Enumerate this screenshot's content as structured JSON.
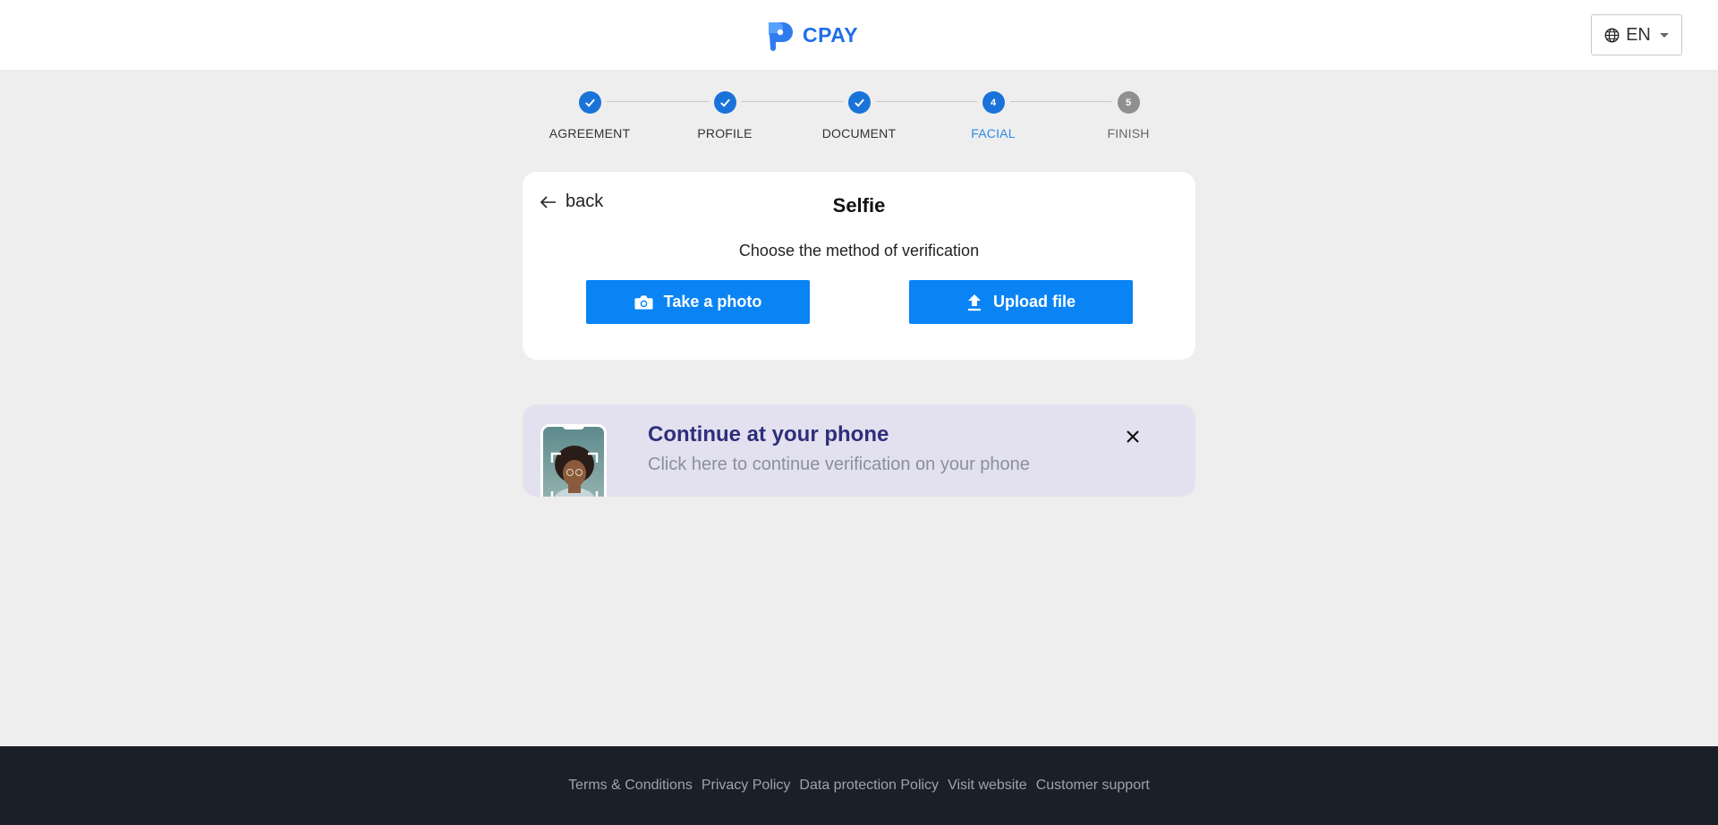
{
  "brand": {
    "name": "CPAY",
    "color": "#1f6fe8"
  },
  "language": {
    "icon": "globe-icon",
    "value": "EN"
  },
  "stepper": {
    "steps": [
      {
        "label": "AGREEMENT",
        "state": "done",
        "number": ""
      },
      {
        "label": "PROFILE",
        "state": "done",
        "number": ""
      },
      {
        "label": "DOCUMENT",
        "state": "done",
        "number": ""
      },
      {
        "label": "FACIAL",
        "state": "active",
        "number": "4"
      },
      {
        "label": "FINISH",
        "state": "todo",
        "number": "5"
      }
    ]
  },
  "card": {
    "back_label": "back",
    "title": "Selfie",
    "subtitle": "Choose the method of verification",
    "take_photo_label": "Take a photo",
    "upload_label": "Upload file"
  },
  "banner": {
    "title": "Continue at your phone",
    "subtitle": "Click here to continue verification on your phone"
  },
  "footer": {
    "links": [
      "Terms & Conditions",
      "Privacy Policy",
      "Data protection Policy",
      "Visit website",
      "Customer support"
    ]
  },
  "colors": {
    "accent": "#0a84f5",
    "step_active": "#1a73d9",
    "step_todo": "#8f8f8f",
    "footer_bg": "#1b1f27",
    "banner_bg": "#e3e1ef"
  }
}
